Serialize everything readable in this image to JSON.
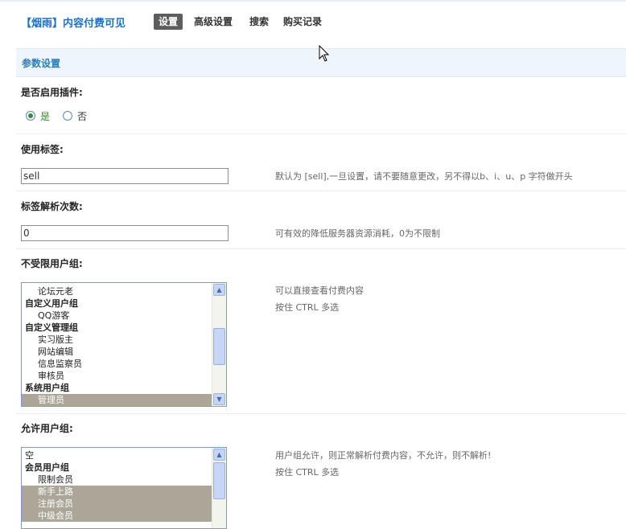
{
  "header": {
    "brand": "【烟雨】内容付费可见",
    "tabs": [
      {
        "label": "设置",
        "active": true
      },
      {
        "label": "高级设置",
        "active": false
      },
      {
        "label": "搜索",
        "active": false
      },
      {
        "label": "购买记录",
        "active": false
      }
    ]
  },
  "section_title": "参数设置",
  "enable_plugin": {
    "label": "是否启用插件:",
    "options": [
      {
        "label": "是",
        "checked": true
      },
      {
        "label": "否",
        "checked": false
      }
    ]
  },
  "tag": {
    "label": "使用标签:",
    "value": "sell",
    "hint": "默认为 [sell],一旦设置，请不要随意更改，另不得以b、i、u、p 字符做开头"
  },
  "parse_count": {
    "label": "标签解析次数:",
    "value": "0",
    "hint": "可有效的降低服务器资源消耗，0为不限制"
  },
  "unlimited_groups": {
    "label": "不受限用户组:",
    "hint1": "可以直接查看付费内容",
    "hint2": "按住 CTRL 多选",
    "options": [
      {
        "label": "论坛元老",
        "group": false,
        "selected": false
      },
      {
        "label": "自定义用户组",
        "group": true,
        "selected": false
      },
      {
        "label": "QQ游客",
        "group": false,
        "selected": false
      },
      {
        "label": "自定义管理组",
        "group": true,
        "selected": false
      },
      {
        "label": "实习版主",
        "group": false,
        "selected": false
      },
      {
        "label": "网站编辑",
        "group": false,
        "selected": false
      },
      {
        "label": "信息监察员",
        "group": false,
        "selected": false
      },
      {
        "label": "审核员",
        "group": false,
        "selected": false
      },
      {
        "label": "系统用户组",
        "group": true,
        "selected": false
      },
      {
        "label": "管理员",
        "group": false,
        "selected": true
      }
    ]
  },
  "allowed_groups": {
    "label": "允许用户组:",
    "hint1": "用户组允许，则正常解析付费内容，不允许，则不解析!",
    "hint2": "按住 CTRL 多选",
    "options": [
      {
        "label": "空",
        "group": false,
        "selected": false,
        "top": true
      },
      {
        "label": "会员用户组",
        "group": true,
        "selected": false
      },
      {
        "label": "限制会员",
        "group": false,
        "selected": false
      },
      {
        "label": "新手上路",
        "group": false,
        "selected": true
      },
      {
        "label": "注册会员",
        "group": false,
        "selected": true
      },
      {
        "label": "中级会员",
        "group": false,
        "selected": true
      }
    ]
  },
  "icons": {
    "scroll_up": "chevron-up-icon",
    "scroll_down": "chevron-down-icon",
    "cursor": "mouse-cursor-icon"
  },
  "colors": {
    "brand": "#1a73c9",
    "active_tab": "#5d5d5d",
    "section_bar": "#eef5fb",
    "selected_option": "#aba698"
  }
}
